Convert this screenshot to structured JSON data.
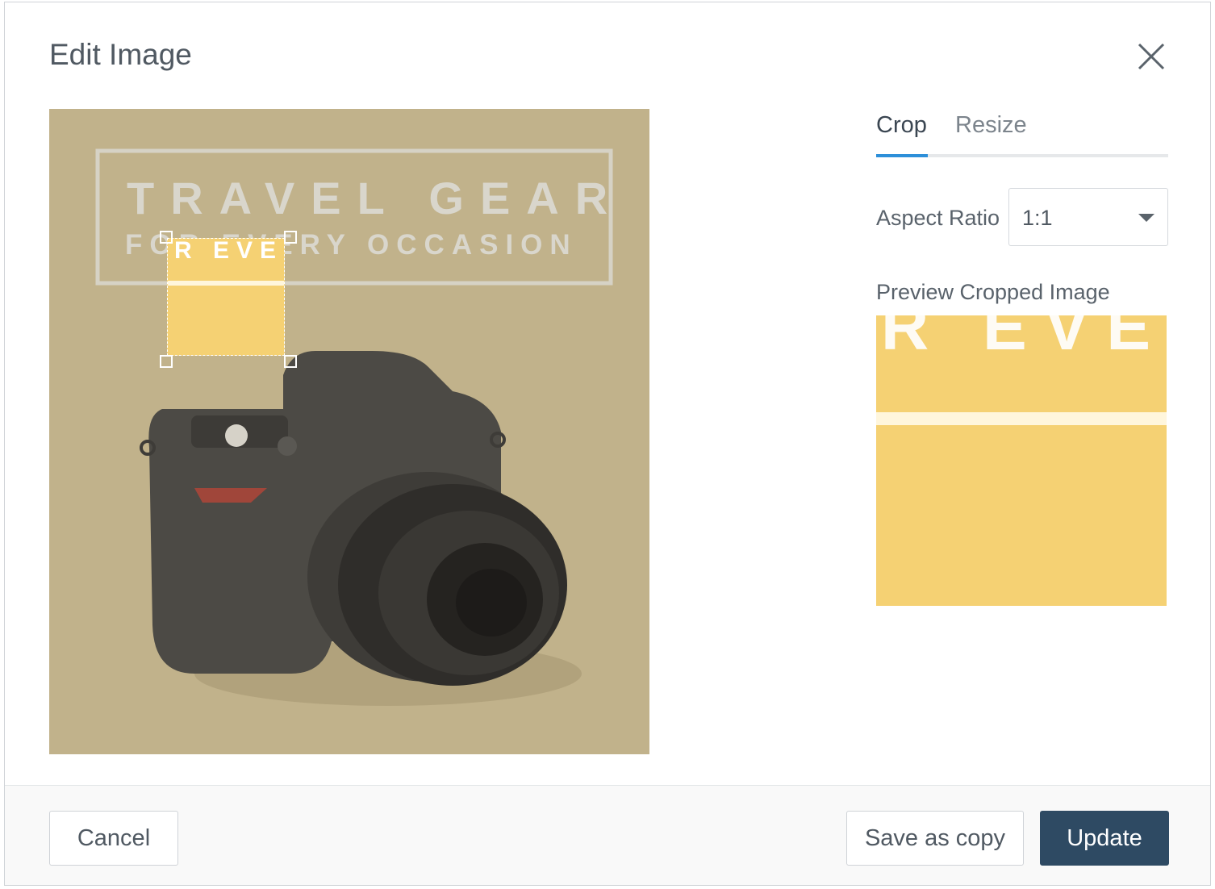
{
  "dialog": {
    "title": "Edit Image",
    "close_icon": "close-icon"
  },
  "canvas": {
    "headline": "TRAVEL GEAR",
    "subline": "FOR EVERY OCCASION",
    "crop_selection_text": "R EVE",
    "bg_color": "#c1b28b",
    "crop_color": "#f5d173"
  },
  "tabs": [
    {
      "label": "Crop",
      "active": true
    },
    {
      "label": "Resize",
      "active": false
    }
  ],
  "aspect_ratio": {
    "label": "Aspect Ratio",
    "value": "1:1"
  },
  "preview": {
    "label": "Preview Cropped Image",
    "text": "R EVE"
  },
  "footer": {
    "cancel_label": "Cancel",
    "save_copy_label": "Save as copy",
    "update_label": "Update"
  },
  "colors": {
    "accent": "#2d8fd9",
    "primary_button": "#2e4a63"
  }
}
